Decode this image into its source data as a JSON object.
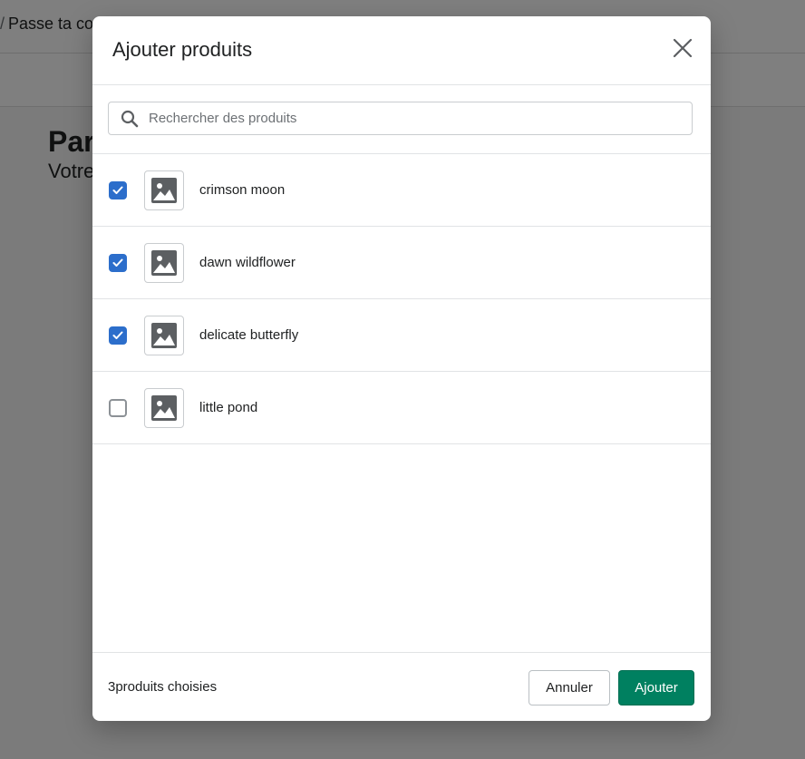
{
  "background": {
    "breadcrumb_separator": "/",
    "breadcrumb_text": "Passe ta co",
    "title_fragment": "Par",
    "subtitle_fragment": "Votre"
  },
  "modal": {
    "title": "Ajouter produits",
    "close_icon": "close-icon",
    "search": {
      "placeholder": "Rechercher des produits",
      "value": "",
      "icon": "search-icon"
    },
    "products": [
      {
        "name": "crimson moon",
        "checked": true
      },
      {
        "name": "dawn wildflower",
        "checked": true
      },
      {
        "name": "delicate butterfly",
        "checked": true
      },
      {
        "name": "little pond",
        "checked": false
      }
    ],
    "footer": {
      "selected_count": "3produits choisies",
      "cancel_label": "Annuler",
      "add_label": "Ajouter"
    }
  },
  "colors": {
    "accent_checkbox": "#2c6ecb",
    "primary_button": "#008060",
    "overlay": "rgba(0,0,0,0.5)"
  }
}
